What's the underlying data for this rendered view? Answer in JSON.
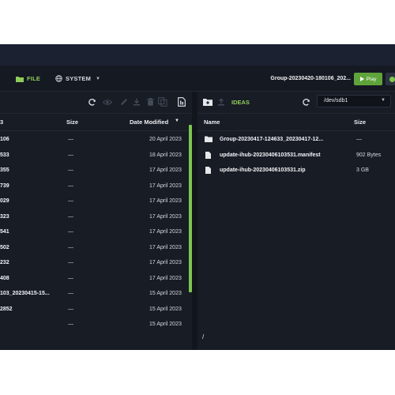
{
  "topbar": {
    "file_label": "FILE",
    "system_label": "SYSTEM",
    "session_name": "Group-20230420-180106_202...",
    "play_label": "Play"
  },
  "left_pane": {
    "header": {
      "partial_title": "3",
      "size": "Size",
      "date": "Date Modified"
    },
    "rows": [
      {
        "name": "106",
        "size": "—",
        "date": "20 April 2023"
      },
      {
        "name": "533",
        "size": "—",
        "date": "18 April 2023"
      },
      {
        "name": "355",
        "size": "—",
        "date": "17 April 2023"
      },
      {
        "name": "739",
        "size": "—",
        "date": "17 April 2023"
      },
      {
        "name": "029",
        "size": "—",
        "date": "17 April 2023"
      },
      {
        "name": "323",
        "size": "—",
        "date": "17 April 2023"
      },
      {
        "name": "541",
        "size": "—",
        "date": "17 April 2023"
      },
      {
        "name": "502",
        "size": "—",
        "date": "17 April 2023"
      },
      {
        "name": "232",
        "size": "—",
        "date": "17 April 2023"
      },
      {
        "name": "408",
        "size": "—",
        "date": "17 April 2023"
      },
      {
        "name": "103_20230415-15...",
        "size": "—",
        "date": "15 April 2023"
      },
      {
        "name": "2852",
        "size": "—",
        "date": "15 April 2023"
      },
      {
        "name": "",
        "size": "—",
        "date": "15 April 2023"
      }
    ]
  },
  "right_pane": {
    "toolbar_label": "IDEAS",
    "device": "/dev/sdb1",
    "header": {
      "name": "Name",
      "size": "Size"
    },
    "rows": [
      {
        "icon": "folder-icon",
        "name": "Group-20230417-124633_20230417-12...",
        "size": "—"
      },
      {
        "icon": "file-icon",
        "name": "update-ihub-20230406103531.manifest",
        "size": "902 Bytes"
      },
      {
        "icon": "file-icon",
        "name": "update-ihub-20230406103531.zip",
        "size": "3 GB"
      }
    ],
    "path": "/"
  },
  "colors": {
    "accent_green": "#7cc74f",
    "background": "#12151c",
    "pane": "#181c25"
  }
}
